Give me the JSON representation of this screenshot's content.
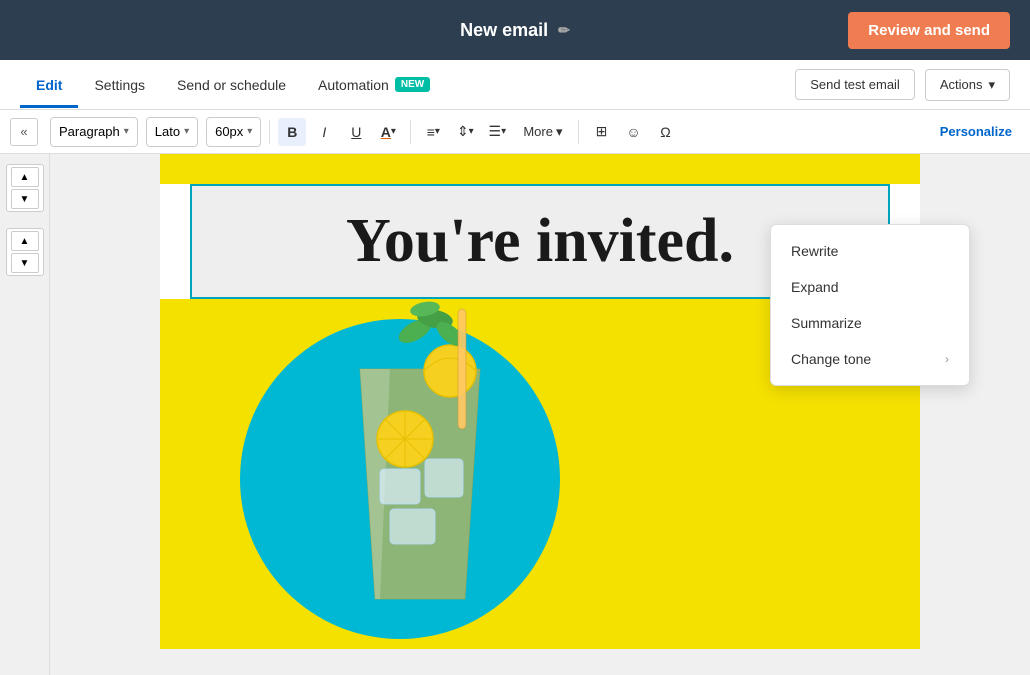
{
  "topbar": {
    "title": "New email",
    "edit_icon": "✏",
    "review_send_label": "Review and send"
  },
  "tabs": {
    "items": [
      {
        "id": "edit",
        "label": "Edit",
        "active": true
      },
      {
        "id": "settings",
        "label": "Settings",
        "active": false
      },
      {
        "id": "send-schedule",
        "label": "Send or schedule",
        "active": false
      },
      {
        "id": "automation",
        "label": "Automation",
        "active": false
      }
    ],
    "new_badge": "NEW",
    "send_test_label": "Send test email",
    "actions_label": "Actions",
    "actions_arrow": "▾"
  },
  "toolbar": {
    "collapse_icon": "«",
    "paragraph_label": "Paragraph",
    "font_label": "Lato",
    "size_label": "60px",
    "bold_label": "B",
    "italic_label": "I",
    "underline_label": "U",
    "font_color_label": "A",
    "align_icon": "≡",
    "spacing_icon": "⇕",
    "list_icon": "☰",
    "more_label": "More",
    "more_arrow": "▾",
    "extra1": "⊞",
    "extra2": "☺",
    "extra3": "Ω",
    "personalize_label": "Personalize"
  },
  "email": {
    "headline": "You're invited.",
    "image_alt": "lemonade drink"
  },
  "context_menu": {
    "items": [
      {
        "id": "rewrite",
        "label": "Rewrite",
        "has_arrow": false
      },
      {
        "id": "expand",
        "label": "Expand",
        "has_arrow": false
      },
      {
        "id": "summarize",
        "label": "Summarize",
        "has_arrow": false
      },
      {
        "id": "change-tone",
        "label": "Change tone",
        "has_arrow": true
      }
    ],
    "chevron": "›"
  },
  "left_panel": {
    "collapse_arrow": "«",
    "up_arrow": "▲",
    "down_arrow": "▼"
  }
}
